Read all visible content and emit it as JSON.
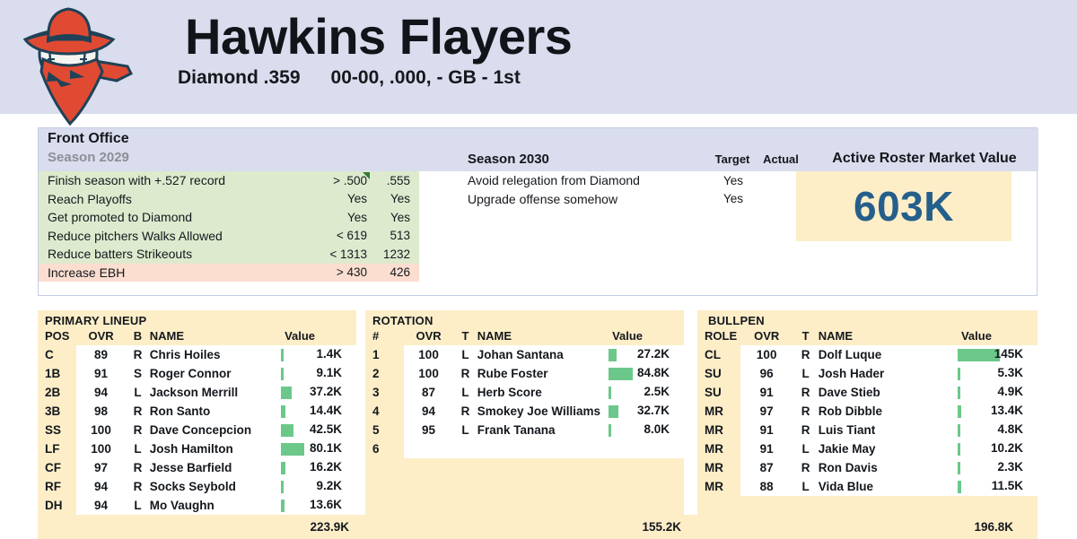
{
  "header": {
    "team_name": "Hawkins Flayers",
    "league": "Diamond .359",
    "record": "00-00, .000, - GB - 1st",
    "logo_name": "cowboy-baseball-logo",
    "colors": {
      "header_bg": "#d9dded",
      "logo_red": "#e04a33",
      "logo_navy": "#1f4257"
    }
  },
  "front_office": {
    "title": "Front Office",
    "season_prev_label": "Season 2029",
    "season_cur_label": "Season 2030",
    "col_target": "Target",
    "col_actual": "Actual",
    "prev_goals": [
      {
        "name": "Finish season with +.527 record",
        "target": "> .500",
        "actual": ".555",
        "met": true,
        "marker": true
      },
      {
        "name": "Reach Playoffs",
        "target": "Yes",
        "actual": "Yes",
        "met": true,
        "marker": false
      },
      {
        "name": "Get promoted to Diamond",
        "target": "Yes",
        "actual": "Yes",
        "met": true,
        "marker": false
      },
      {
        "name": "Reduce pitchers Walks Allowed",
        "target": "< 619",
        "actual": "513",
        "met": true,
        "marker": false
      },
      {
        "name": "Reduce batters Strikeouts",
        "target": "< 1313",
        "actual": "1232",
        "met": true,
        "marker": false
      },
      {
        "name": "Increase EBH",
        "target": "> 430",
        "actual": "426",
        "met": false,
        "marker": false
      }
    ],
    "cur_goals": [
      {
        "name": "Avoid relegation from Diamond",
        "target": "Yes",
        "actual": ""
      },
      {
        "name": "Upgrade offense somehow",
        "target": "Yes",
        "actual": ""
      }
    ],
    "market_value": {
      "label": "Active Roster Market Value",
      "value": "603K"
    }
  },
  "lineup": {
    "section_title": "PRIMARY LINEUP",
    "headers": {
      "pos": "POS",
      "ovr": "OVR",
      "hand": "B",
      "name": "NAME",
      "value": "Value"
    },
    "rows": [
      {
        "pos": "C",
        "ovr": "89",
        "tier": "yellow",
        "hand": "R",
        "name": "Chris Hoiles",
        "value": "1.4K",
        "bar": 1.4
      },
      {
        "pos": "1B",
        "ovr": "91",
        "tier": "blue",
        "hand": "S",
        "name": "Roger Connor",
        "value": "9.1K",
        "bar": 9.1
      },
      {
        "pos": "2B",
        "ovr": "94",
        "tier": "blue",
        "hand": "L",
        "name": "Jackson Merrill",
        "value": "37.2K",
        "bar": 37.2
      },
      {
        "pos": "3B",
        "ovr": "98",
        "tier": "blue",
        "hand": "R",
        "name": "Ron Santo",
        "value": "14.4K",
        "bar": 14.4
      },
      {
        "pos": "SS",
        "ovr": "100",
        "tier": "black",
        "hand": "R",
        "name": "Dave Concepcion",
        "value": "42.5K",
        "bar": 42.5
      },
      {
        "pos": "LF",
        "ovr": "100",
        "tier": "black",
        "hand": "L",
        "name": "Josh Hamilton",
        "value": "80.1K",
        "bar": 80.1
      },
      {
        "pos": "CF",
        "ovr": "97",
        "tier": "blue",
        "hand": "R",
        "name": "Jesse Barfield",
        "value": "16.2K",
        "bar": 16.2
      },
      {
        "pos": "RF",
        "ovr": "94",
        "tier": "blue",
        "hand": "R",
        "name": "Socks Seybold",
        "value": "9.2K",
        "bar": 9.2
      },
      {
        "pos": "DH",
        "ovr": "94",
        "tier": "blue",
        "hand": "L",
        "name": "Mo Vaughn",
        "value": "13.6K",
        "bar": 13.6
      }
    ],
    "total": "223.9K"
  },
  "rotation": {
    "section_title": "ROTATION",
    "headers": {
      "pos": "#",
      "ovr": "OVR",
      "hand": "T",
      "name": "NAME",
      "value": "Value"
    },
    "rows": [
      {
        "pos": "1",
        "ovr": "100",
        "tier": "black",
        "hand": "L",
        "name": "Johan Santana",
        "value": "27.2K",
        "bar": 27.2,
        "small": false
      },
      {
        "pos": "2",
        "ovr": "100",
        "tier": "black",
        "hand": "R",
        "name": "Rube Foster",
        "value": "84.8K",
        "bar": 84.8,
        "small": false
      },
      {
        "pos": "3",
        "ovr": "87",
        "tier": "yellow",
        "hand": "L",
        "name": "Herb Score",
        "value": "2.5K",
        "bar": 2.5,
        "small": false
      },
      {
        "pos": "4",
        "ovr": "94",
        "tier": "blue",
        "hand": "R",
        "name": "Smokey Joe Williams",
        "value": "32.7K",
        "bar": 32.7,
        "small": true
      },
      {
        "pos": "5",
        "ovr": "95",
        "tier": "blue",
        "hand": "L",
        "name": "Frank Tanana",
        "value": "8.0K",
        "bar": 8.0,
        "small": false
      },
      {
        "pos": "6",
        "ovr": "",
        "tier": "empty",
        "hand": "",
        "name": "",
        "value": "",
        "bar": 0,
        "small": false
      }
    ],
    "total": "155.2K"
  },
  "bullpen": {
    "section_title": "BULLPEN",
    "headers": {
      "pos": "ROLE",
      "ovr": "OVR",
      "hand": "T",
      "name": "NAME",
      "value": "Value"
    },
    "rows": [
      {
        "pos": "CL",
        "ovr": "100",
        "tier": "black",
        "hand": "R",
        "name": "Dolf Luque",
        "value": "145K",
        "bar": 145
      },
      {
        "pos": "SU",
        "ovr": "96",
        "tier": "blue",
        "hand": "L",
        "name": "Josh Hader",
        "value": "5.3K",
        "bar": 5.3
      },
      {
        "pos": "SU",
        "ovr": "91",
        "tier": "blue",
        "hand": "R",
        "name": "Dave Stieb",
        "value": "4.9K",
        "bar": 4.9
      },
      {
        "pos": "MR",
        "ovr": "97",
        "tier": "blue",
        "hand": "R",
        "name": "Rob Dibble",
        "value": "13.4K",
        "bar": 13.4
      },
      {
        "pos": "MR",
        "ovr": "91",
        "tier": "blue",
        "hand": "R",
        "name": "Luis Tiant",
        "value": "4.8K",
        "bar": 4.8
      },
      {
        "pos": "MR",
        "ovr": "91",
        "tier": "blue",
        "hand": "L",
        "name": "Jakie May",
        "value": "10.2K",
        "bar": 10.2
      },
      {
        "pos": "MR",
        "ovr": "87",
        "tier": "yellow",
        "hand": "R",
        "name": "Ron Davis",
        "value": "2.3K",
        "bar": 2.3
      },
      {
        "pos": "MR",
        "ovr": "88",
        "tier": "yellow",
        "hand": "L",
        "name": "Vida Blue",
        "value": "11.5K",
        "bar": 11.5
      }
    ],
    "total": "196.8K"
  }
}
